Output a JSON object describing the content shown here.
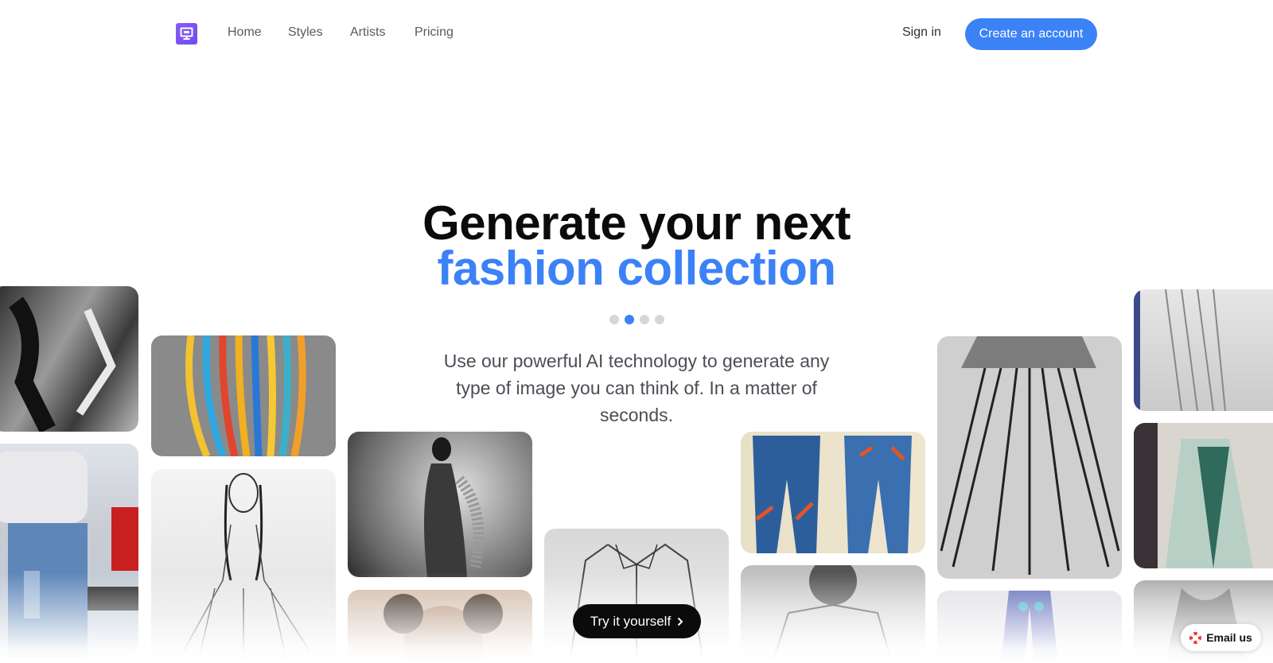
{
  "nav": {
    "links": [
      "Home",
      "Styles",
      "Artists",
      "Pricing"
    ],
    "sign_in": "Sign in",
    "create_account": "Create an account"
  },
  "hero": {
    "title_line1": "Generate your next",
    "title_line2": "fashion collection",
    "subtitle": "Use our powerful AI technology to generate any type of image you can think of. In a matter of seconds.",
    "carousel_active_index": 1,
    "carousel_count": 4
  },
  "try_button": "Try it yourself",
  "email_button": "Email us",
  "colors": {
    "accent": "#3b82f6",
    "dark": "#0b0b0b",
    "logo": "#7c5cf4"
  }
}
